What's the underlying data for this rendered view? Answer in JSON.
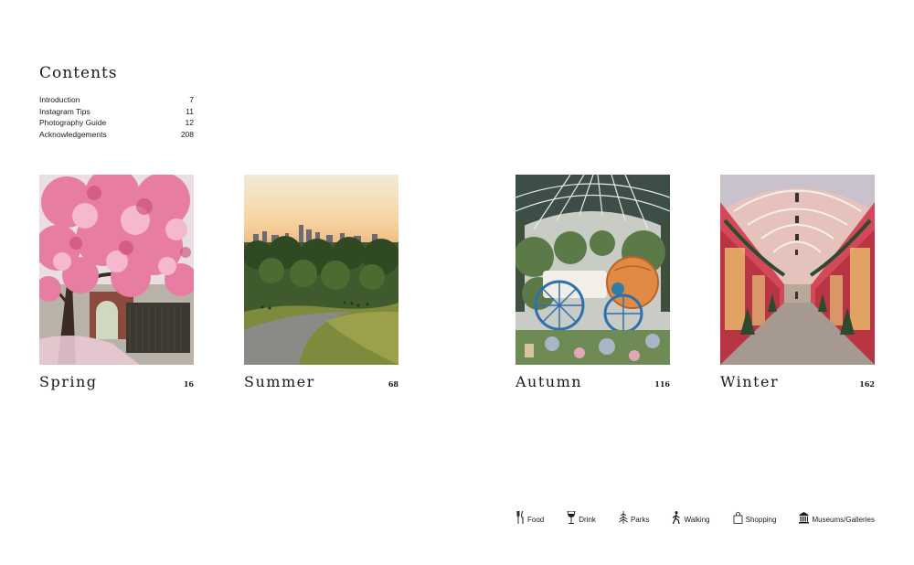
{
  "contents": {
    "title": "Contents",
    "entries": [
      {
        "label": "Introduction",
        "page": "7"
      },
      {
        "label": "Instagram Tips",
        "page": "11"
      },
      {
        "label": "Photography Guide",
        "page": "12"
      },
      {
        "label": "Acknowledgements",
        "page": "208"
      }
    ]
  },
  "seasons": [
    {
      "name": "Spring",
      "page": "16",
      "photo": "pink-blossom-tree-with-brick-archway"
    },
    {
      "name": "Summer",
      "page": "68",
      "photo": "park-at-sunset-with-city-skyline"
    },
    {
      "name": "Autumn",
      "page": "116",
      "photo": "covent-garden-market-hall-with-pumpkin-carriage"
    },
    {
      "name": "Winter",
      "page": "162",
      "photo": "victorian-shopping-arcade-with-christmas-trees"
    }
  ],
  "legend": [
    {
      "label": "Food",
      "icon": "fork-knife-icon"
    },
    {
      "label": "Drink",
      "icon": "wine-glass-icon"
    },
    {
      "label": "Parks",
      "icon": "tree-icon"
    },
    {
      "label": "Walking",
      "icon": "walking-person-icon"
    },
    {
      "label": "Shopping",
      "icon": "shopping-bag-icon"
    },
    {
      "label": "Museums/Galleries",
      "icon": "museum-icon"
    }
  ]
}
